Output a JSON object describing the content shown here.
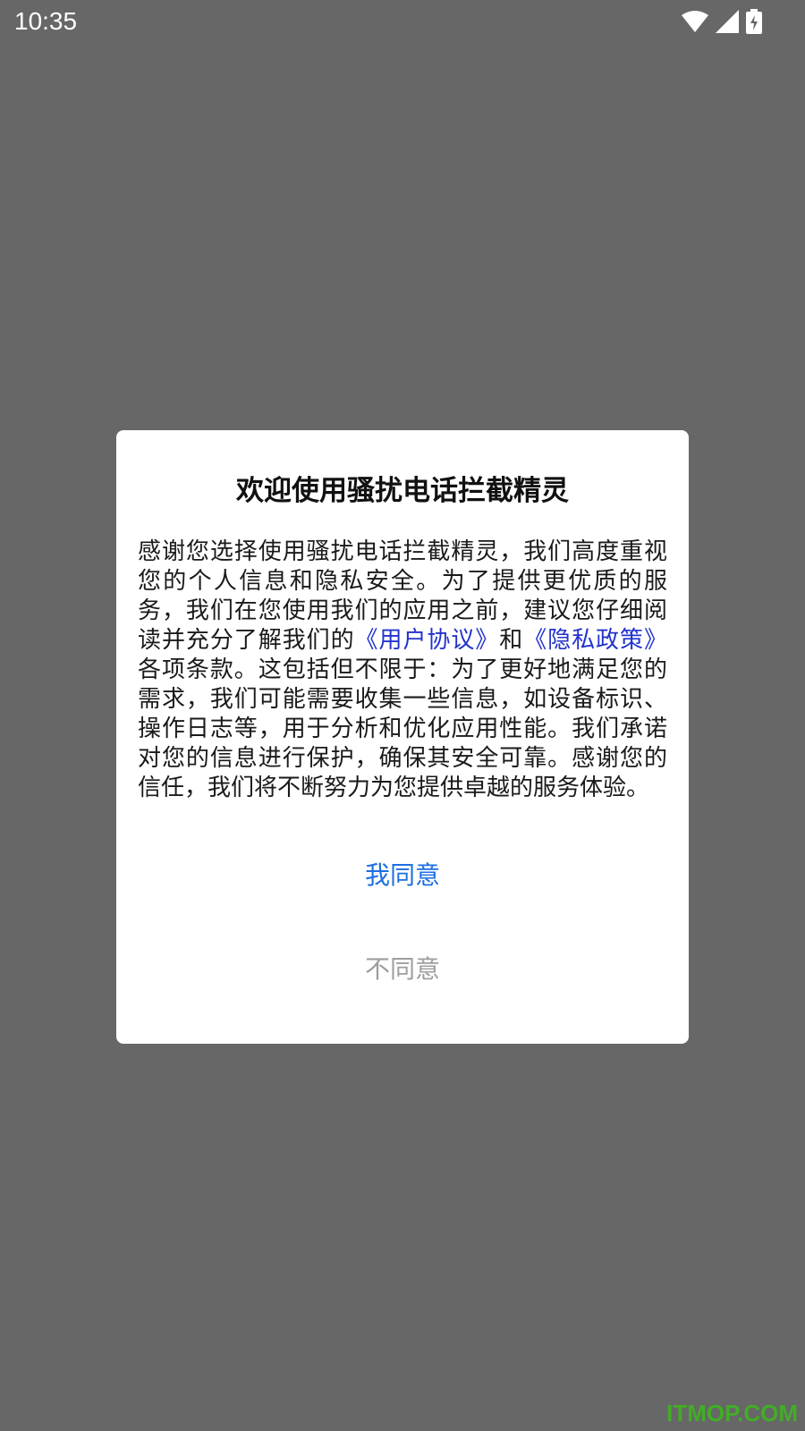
{
  "status_bar": {
    "time": "10:35",
    "icons": [
      "wifi-icon",
      "cell-signal-icon",
      "battery-charging-icon"
    ]
  },
  "dialog": {
    "title": "欢迎使用骚扰电话拦截精灵",
    "body_part1": "感谢您选择使用骚扰电话拦截精灵，我们高度重视您的个人信息和隐私安全。为了提供更优质的服务，我们在您使用我们的应用之前，建议您仔细阅读并充分了解我们的",
    "link_user_agreement": "《用户协议》",
    "body_and": "和",
    "link_privacy_policy": "《隐私政策》",
    "body_part2": "各项条款。这包括但不限于：为了更好地满足您的需求，我们可能需要收集一些信息，如设备标识、操作日志等，用于分析和优化应用性能。我们承诺对您的信息进行保护，确保其安全可靠。感谢您的信任，我们将不断努力为您提供卓越的服务体验。",
    "agree_label": "我同意",
    "disagree_label": "不同意"
  },
  "watermark": "ITMOP.COM",
  "colors": {
    "overlay": "#676767",
    "link": "#2233cc",
    "agree": "#1d6fe0",
    "disagree": "#9e9e9e",
    "watermark": "#3fb51f"
  }
}
